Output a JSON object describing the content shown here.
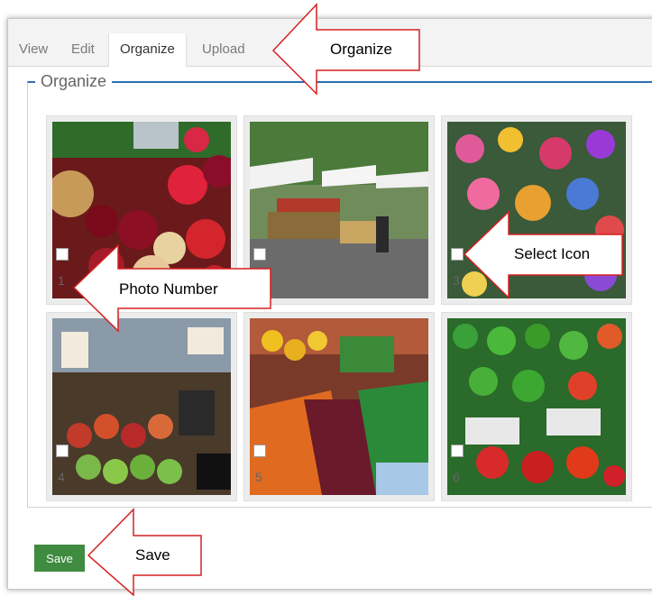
{
  "tabs": [
    {
      "label": "View"
    },
    {
      "label": "Edit"
    },
    {
      "label": "Organize",
      "active": true
    },
    {
      "label": "Upload"
    }
  ],
  "section_title": "Organize",
  "photos": [
    {
      "number": "1"
    },
    {
      "number": "2"
    },
    {
      "number": "3"
    },
    {
      "number": "4"
    },
    {
      "number": "5"
    },
    {
      "number": "6"
    }
  ],
  "save_label": "Save",
  "callouts": {
    "organize": "Organize",
    "select_icon": "Select Icon",
    "photo_number": "Photo Number",
    "save": "Save"
  },
  "colors": {
    "accent_blue": "#2a6fb3",
    "save_green": "#3f8b3f",
    "callout_border": "#d62020"
  }
}
